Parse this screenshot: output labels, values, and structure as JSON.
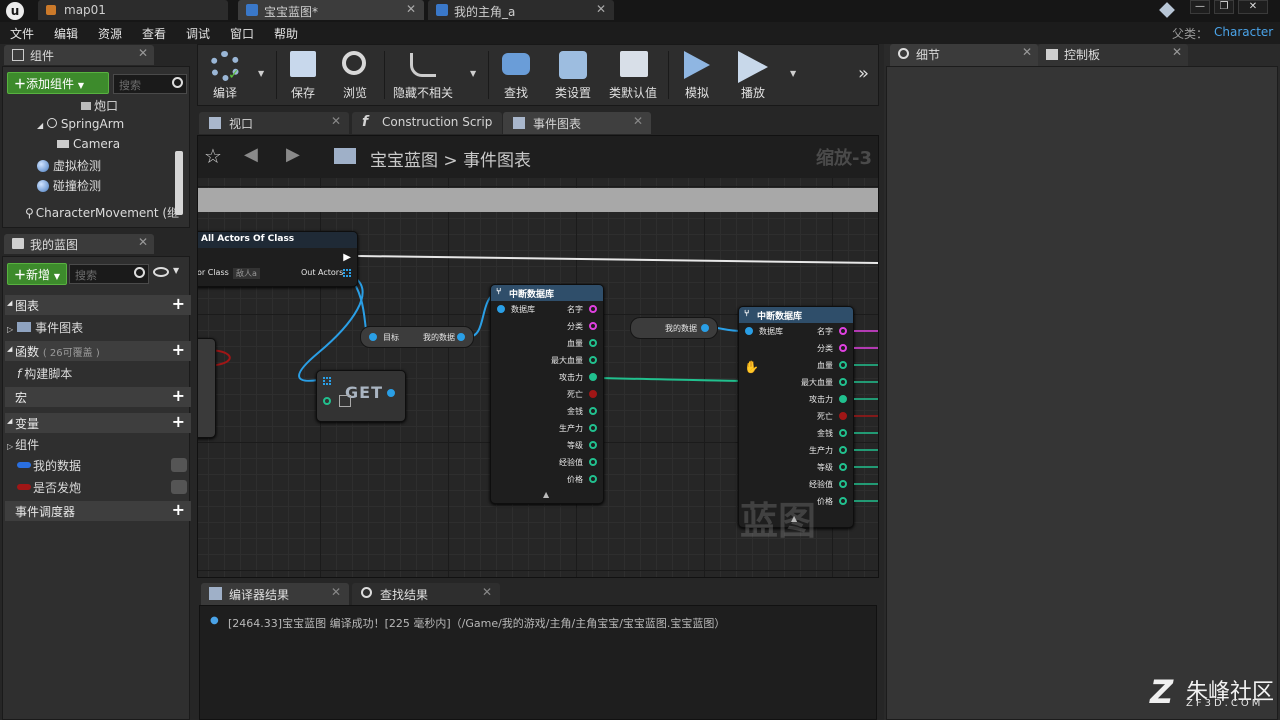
{
  "doc_tabs": {
    "map": "map01",
    "blueprint": "宝宝蓝图*",
    "character": "我的主角_a"
  },
  "menu": [
    "文件",
    "编辑",
    "资源",
    "查看",
    "调试",
    "窗口",
    "帮助"
  ],
  "parent_class": {
    "label": "父类：",
    "value": "Character"
  },
  "components_panel": {
    "tab": "组件",
    "add_button": "添加组件",
    "search_placeholder": "搜索",
    "tree": [
      "炮口",
      "SpringArm",
      "Camera",
      "虚拟检测",
      "碰撞检测",
      "CharacterMovement (继"
    ]
  },
  "my_blueprint_panel": {
    "tab": "我的蓝图",
    "new_button": "新增",
    "search_placeholder": "搜索",
    "graphs_header": "图表",
    "event_graph": "事件图表",
    "functions_header": "函数",
    "functions_note": "( 26可覆盖 )",
    "construction_script": "构建脚本",
    "macros_header": "宏",
    "variables_header": "变量",
    "components_group": "组件",
    "variables": [
      {
        "name": "我的数据",
        "color": "#2a6fe0"
      },
      {
        "name": "是否发炮",
        "color": "#a01616"
      }
    ],
    "dispatchers_header": "事件调度器"
  },
  "toolbar": {
    "compile": "编译",
    "save": "保存",
    "browse": "浏览",
    "hide_unrelated": "隐藏不相关",
    "find": "查找",
    "class_settings": "类设置",
    "class_defaults": "类默认值",
    "simulate": "模拟",
    "play": "播放"
  },
  "graph_tabs": {
    "viewport": "视口",
    "construction": "Construction Scrip",
    "event_graph": "事件图表"
  },
  "breadcrumb": {
    "root": "宝宝蓝图",
    "separator": ">",
    "current": "事件图表"
  },
  "zoom": "缩放-3",
  "nodes": {
    "get_all_actors": {
      "title": "All Actors Of Class",
      "actor_class": "or Class",
      "class_value": "敌人a",
      "out": "Out Actors"
    },
    "target_node": {
      "target": "目标",
      "data": "我的数据"
    },
    "get_node": "GET",
    "break_a": {
      "title": "中断数据库",
      "input": "数据库",
      "outputs": [
        "名字",
        "分类",
        "血量",
        "最大血量",
        "攻击力",
        "死亡",
        "金钱",
        "生产力",
        "等级",
        "经验值",
        "价格"
      ]
    },
    "my_data_node": "我的数据",
    "break_b": {
      "title": "中断数据库",
      "input": "数据库",
      "outputs": [
        "名字",
        "分类",
        "血量",
        "最大血量",
        "攻击力",
        "死亡",
        "金钱",
        "生产力",
        "等级",
        "经验值",
        "价格"
      ]
    },
    "graph_watermark": "蓝图"
  },
  "results_tabs": {
    "compiler": "编译器结果",
    "find": "查找结果"
  },
  "compiler_log": "[2464.33]宝宝蓝图 编译成功！[225 毫秒内]（/Game/我的游戏/主角/主角宝宝/宝宝蓝图.宝宝蓝图）",
  "right_tabs": {
    "details": "细节",
    "palette": "控制板"
  },
  "site_logo": {
    "name": "朱峰社区",
    "url": "ZF3D.COM"
  }
}
